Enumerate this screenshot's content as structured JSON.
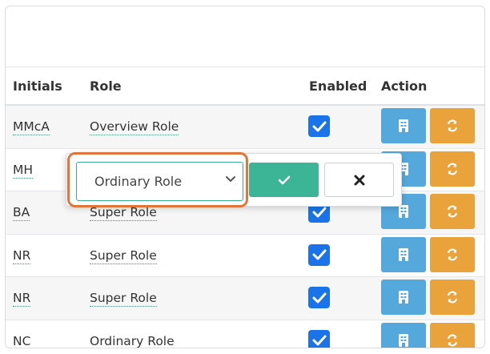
{
  "table": {
    "headers": {
      "initials": "Initials",
      "role": "Role",
      "enabled": "Enabled",
      "action": "Action"
    },
    "rows": [
      {
        "initials": "MMcA",
        "role": "Overview Role",
        "enabled": true
      },
      {
        "initials": "MH",
        "role": "",
        "enabled": true
      },
      {
        "initials": "BA",
        "role": "Super Role",
        "enabled": true
      },
      {
        "initials": "NR",
        "role": "Super Role",
        "enabled": true
      },
      {
        "initials": "NR",
        "role": "Super Role",
        "enabled": true
      },
      {
        "initials": "NC",
        "role": "Ordinary Role",
        "enabled": true
      }
    ]
  },
  "editor": {
    "selected_role": "Ordinary Role",
    "confirm_icon": "check-icon",
    "cancel_icon": "close-icon"
  },
  "icons": {
    "details": "document-icon",
    "reset": "refresh-icon"
  },
  "colors": {
    "checkbox": "#1a73e8",
    "details_button": "#55a8dc",
    "reset_button": "#eaa33a",
    "confirm_button": "#3cb597",
    "highlight": "#e0763a"
  }
}
